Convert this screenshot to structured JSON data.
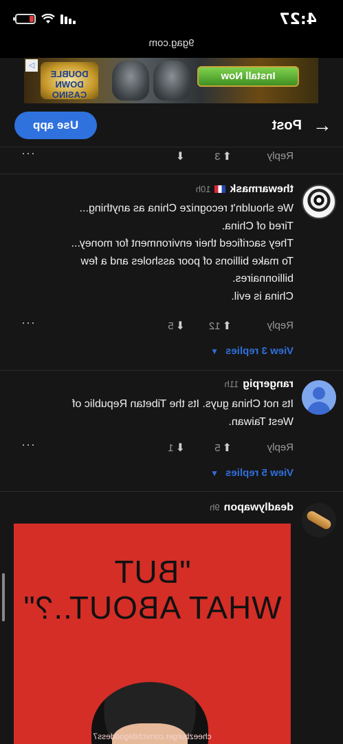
{
  "status": {
    "time": "4:27",
    "battery_level": 0.25
  },
  "url": "9gag.com",
  "ad": {
    "install_label": "Install Now",
    "brand": "DOUBLE DOWN",
    "brand_sub": "CASINO",
    "adchoices": "▷"
  },
  "header": {
    "title": "Post",
    "use_app": "Use app",
    "back_icon": "arrow-left-icon"
  },
  "top_actions": {
    "reply": "Reply",
    "up": "3",
    "down": "",
    "more": "···"
  },
  "comments": [
    {
      "user": "thewarmask",
      "time": "10h",
      "lines": [
        "We shouldn't recognize China as anything...",
        "Tired of China.",
        "They sacrificed their environment for money...",
        "To make billions of poor assholes and a few",
        "billionnaires.",
        "China is evil."
      ],
      "reply": "Reply",
      "up": "12",
      "down": "5",
      "more": "···",
      "view_replies": "View 3 replies"
    },
    {
      "user": "rangerpig",
      "time": "11h",
      "lines": [
        "Its not China guys. Its the Tibetan Republic of",
        "West Taiwan."
      ],
      "reply": "Reply",
      "up": "5",
      "down": "1",
      "more": "···",
      "view_replies": "View 5 replies"
    },
    {
      "user": "deadlywapon",
      "time": "9h",
      "meme_lines": [
        "\"BUT",
        "WHAT ABOUT..?\""
      ],
      "watermark": "cheezburger.com/chibigoddess7"
    }
  ]
}
